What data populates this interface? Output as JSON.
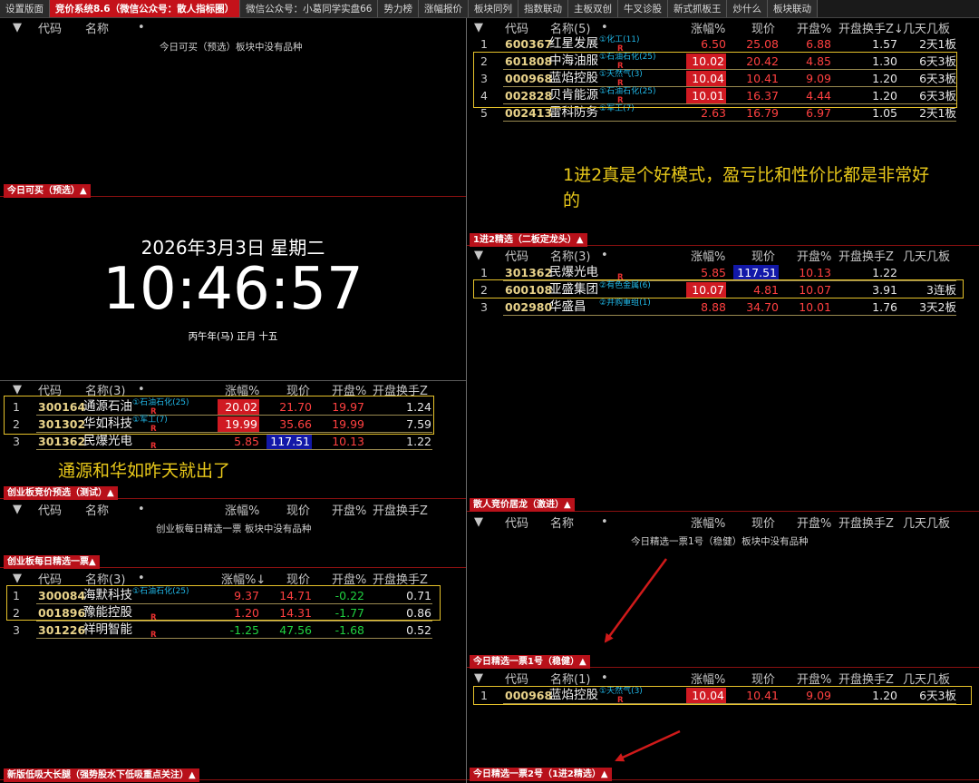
{
  "tabs": [
    "设置版面",
    "竞价系统8.6（微信公众号：散人指标圈）",
    "微信公众号：小葛同学实盘66",
    "势力榜",
    "涨幅报价",
    "板块同列",
    "指数联动",
    "主板双创",
    "牛叉诊股",
    "新式抓板王",
    "炒什么",
    "板块联动"
  ],
  "clock": {
    "date": "2026年3月3日 星期二",
    "time": "10:46:57",
    "lunar": "丙午年(马) 正月 十五"
  },
  "headers": {
    "idx": "",
    "code": "代码",
    "name": "名称",
    "name3": "名称(3)",
    "name5": "名称(5)",
    "name1": "名称(1)",
    "dot": "•",
    "chg": "涨幅%",
    "price": "现价",
    "open": "开盘%",
    "turn": "开盘换手Z",
    "days": "几天几板"
  },
  "left": {
    "p1": {
      "label": "今日可买（预选）▲",
      "empty": "今日可买（预选）板块中没有品种"
    },
    "p2": {
      "label": "创业板竞价预选（测试）▲",
      "rows": [
        {
          "i": "1",
          "code": "300164",
          "name": "通源石油",
          "tag": "①石油石化(25)",
          "r": "R",
          "chg": "20.02",
          "price": "21.70",
          "open": "19.97",
          "turn": "1.24"
        },
        {
          "i": "2",
          "code": "301302",
          "name": "华如科技",
          "tag": "①军工(7)",
          "r": "R",
          "chg": "19.99",
          "price": "35.66",
          "open": "19.99",
          "turn": "7.59"
        },
        {
          "i": "3",
          "code": "301362",
          "name": "民爆光电",
          "tag": "",
          "r": "R",
          "chg": "5.85",
          "price": "117.51",
          "open": "10.13",
          "turn": "1.22"
        }
      ]
    },
    "p3": {
      "label": "创业板每日精选一票▲",
      "empty": "创业板每日精选一票 板块中没有品种"
    },
    "p4": {
      "label": "新版低吸大长腿（强势股水下低吸重点关注）▲",
      "chg_hdr": "涨幅%↓",
      "rows": [
        {
          "i": "1",
          "code": "300084",
          "name": "海默科技",
          "tag": "①石油石化(25)",
          "r": "",
          "chg": "9.37",
          "price": "14.71",
          "open": "-0.22",
          "turn": "0.71"
        },
        {
          "i": "2",
          "code": "001896",
          "name": "豫能控股",
          "tag": "",
          "r": "R",
          "chg": "1.20",
          "price": "14.31",
          "open": "-1.77",
          "turn": "0.86"
        },
        {
          "i": "3",
          "code": "301226",
          "name": "祥明智能",
          "tag": "",
          "r": "R",
          "chg": "-1.25",
          "price": "47.56",
          "open": "-1.68",
          "turn": "0.52"
        }
      ]
    }
  },
  "right": {
    "p1": {
      "label": "1进2精选（二板定龙头）▲",
      "turn_hdr": "开盘换手Z↓",
      "rows": [
        {
          "i": "1",
          "code": "600367",
          "name": "红星发展",
          "tag": "①化工(11)",
          "r": "R",
          "chg": "6.50",
          "price": "25.08",
          "open": "6.88",
          "turn": "1.57",
          "days": "2天1板"
        },
        {
          "i": "2",
          "code": "601808",
          "name": "中海油服",
          "tag": "①石油石化(25)",
          "r": "R",
          "chg": "10.02",
          "price": "20.42",
          "open": "4.85",
          "turn": "1.30",
          "days": "6天3板"
        },
        {
          "i": "3",
          "code": "000968",
          "name": "蓝焰控股",
          "tag": "①天然气(3)",
          "r": "R",
          "chg": "10.04",
          "price": "10.41",
          "open": "9.09",
          "turn": "1.20",
          "days": "6天3板"
        },
        {
          "i": "4",
          "code": "002828",
          "name": "贝肯能源",
          "tag": "①石油石化(25)",
          "r": "R",
          "chg": "10.01",
          "price": "16.37",
          "open": "4.44",
          "turn": "1.20",
          "days": "6天3板"
        },
        {
          "i": "5",
          "code": "002413",
          "name": "雷科防务",
          "tag": "①军工(7)",
          "r": "",
          "chg": "2.63",
          "price": "16.79",
          "open": "6.97",
          "turn": "1.05",
          "days": "2天1板"
        }
      ]
    },
    "p2": {
      "label": "散人竞价居龙（激进）▲",
      "rows": [
        {
          "i": "1",
          "code": "301362",
          "name": "民爆光电",
          "tag": "",
          "r": "R",
          "chg": "5.85",
          "price": "117.51",
          "open": "10.13",
          "turn": "1.22",
          "days": ""
        },
        {
          "i": "2",
          "code": "600108",
          "name": "亚盛集团",
          "tag": "②有色金属(6)",
          "r": "",
          "chg": "10.07",
          "price": "4.81",
          "open": "10.07",
          "turn": "3.91",
          "days": "3连板"
        },
        {
          "i": "3",
          "code": "002980",
          "name": "华盛昌",
          "tag": "②并购重组(1)",
          "r": "",
          "chg": "8.88",
          "price": "34.70",
          "open": "10.01",
          "turn": "1.76",
          "days": "3天2板"
        }
      ]
    },
    "p3": {
      "label": "今日精选一票1号（稳健）▲",
      "empty": "今日精选一票1号（稳健）板块中没有品种"
    },
    "p4": {
      "label": "今日精选一票2号（1进2精选）▲",
      "rows": [
        {
          "i": "1",
          "code": "000968",
          "name": "蓝焰控股",
          "tag": "①天然气(3)",
          "r": "R",
          "chg": "10.04",
          "price": "10.41",
          "open": "9.09",
          "turn": "1.20",
          "days": "6天3板"
        }
      ]
    }
  },
  "annotations": {
    "right_note_line1": "1进2真是个好模式，盈亏比和性价比都是非常好",
    "right_note_line2": "的",
    "left_note": "通源和华如昨天就出了"
  },
  "colors": {
    "accent": "#c4121a",
    "highlight_box": "#e6c22a",
    "arrow": "#d01a1a"
  }
}
